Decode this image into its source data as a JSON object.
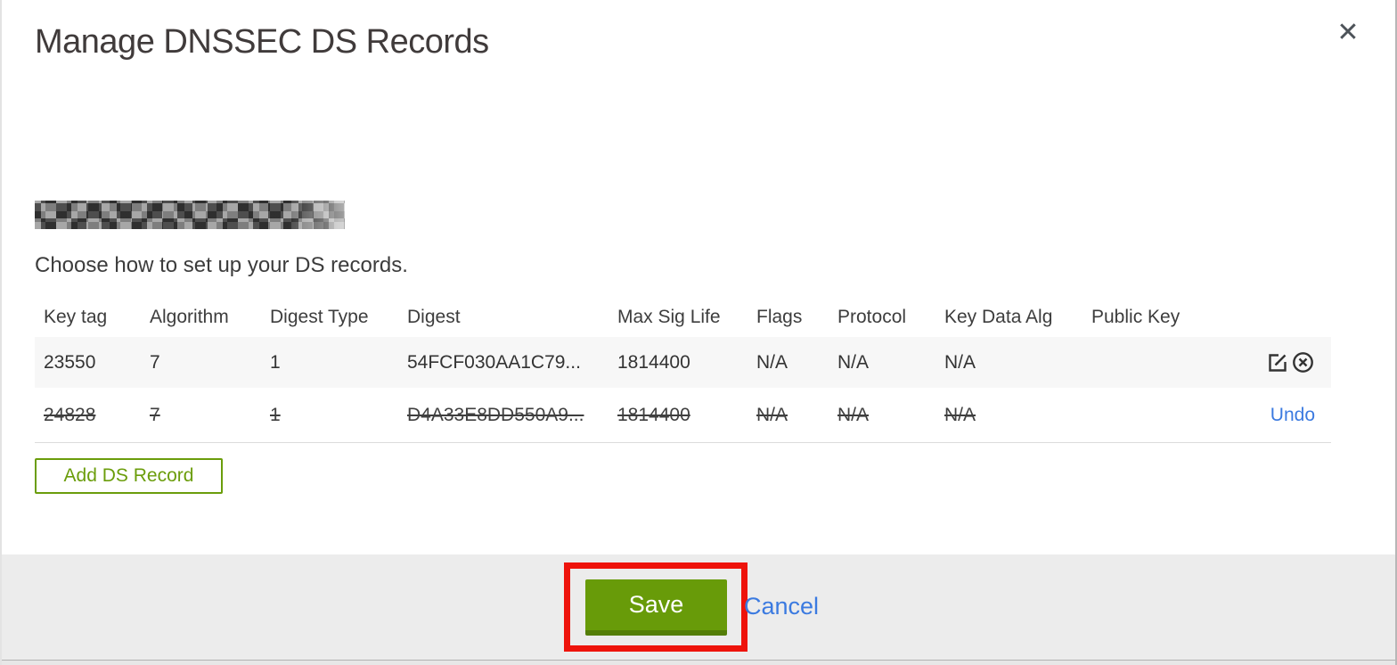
{
  "modal": {
    "title": "Manage DNSSEC DS Records",
    "close_icon": "✕",
    "instruction": "Choose how to set up your DS records.",
    "domain": {
      "redacted": true,
      "label": "domain-name-redacted"
    }
  },
  "table": {
    "columns": [
      "Key tag",
      "Algorithm",
      "Digest Type",
      "Digest",
      "Max Sig Life",
      "Flags",
      "Protocol",
      "Key Data Alg",
      "Public Key"
    ],
    "rows": [
      {
        "key_tag": "23550",
        "algorithm": "7",
        "digest_type": "1",
        "digest": "54FCF030AA1C79...",
        "max_sig_life": "1814400",
        "flags": "N/A",
        "protocol": "N/A",
        "key_data_alg": "N/A",
        "public_key": "",
        "state": "active"
      },
      {
        "key_tag": "24828",
        "algorithm": "7",
        "digest_type": "1",
        "digest": "D4A33E8DD550A9...",
        "max_sig_life": "1814400",
        "flags": "N/A",
        "protocol": "N/A",
        "key_data_alg": "N/A",
        "public_key": "",
        "state": "marked-for-deletion",
        "undo_label": "Undo"
      }
    ]
  },
  "actions": {
    "add_ds_record": "Add DS Record",
    "save": "Save",
    "cancel": "Cancel"
  },
  "colors": {
    "primary_green": "#689B09",
    "green_dark": "#547E08",
    "link_blue": "#3B7AE0",
    "annotation_red": "#EE130B",
    "row_highlight": "#F7F7F7",
    "footer_gray": "#ECECEC"
  },
  "annotation": {
    "type": "highlight-box",
    "target": "save-button"
  }
}
